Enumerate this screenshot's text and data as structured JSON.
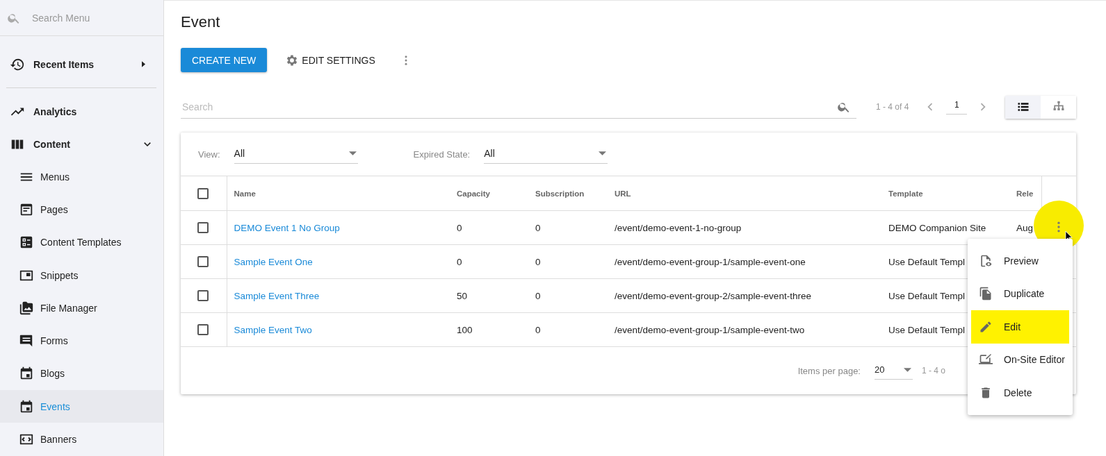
{
  "sidebar": {
    "search": {
      "placeholder": "Search Menu"
    },
    "items": [
      {
        "label": "Recent Items",
        "kind": "toggle",
        "expanded": false
      },
      {
        "kind": "divider"
      },
      {
        "label": "Analytics",
        "kind": "top"
      },
      {
        "label": "Content",
        "kind": "toggle",
        "expanded": true,
        "children": [
          {
            "label": "Menus",
            "selected": false
          },
          {
            "label": "Pages",
            "selected": false
          },
          {
            "label": "Content Templates",
            "selected": false
          },
          {
            "label": "Snippets",
            "selected": false
          },
          {
            "label": "File Manager",
            "selected": false
          },
          {
            "label": "Forms",
            "selected": false
          },
          {
            "label": "Blogs",
            "selected": false
          },
          {
            "label": "Events",
            "selected": true
          },
          {
            "label": "Banners",
            "selected": false
          }
        ]
      }
    ]
  },
  "page": {
    "title": "Event",
    "create_button": "CREATE NEW",
    "settings_button": "EDIT SETTINGS"
  },
  "search": {
    "placeholder": "Search"
  },
  "pager": {
    "range": "1 - 4 of 4",
    "page": "1"
  },
  "view_toggle": [
    {
      "selected": true
    },
    {
      "selected": false
    }
  ],
  "filters": [
    {
      "label": "View:",
      "value": "All"
    },
    {
      "label": "Expired State:",
      "value": "All"
    }
  ],
  "table": {
    "all_checked": false,
    "columns": [
      "Name",
      "Capacity",
      "Subscription",
      "URL",
      "Template",
      "Rele"
    ],
    "rows": [
      {
        "checked": false,
        "name": "DEMO Event 1 No Group",
        "capacity": "0",
        "subscription": "0",
        "url": "/event/demo-event-1-no-group",
        "template": "DEMO Companion Site",
        "release": "Aug"
      },
      {
        "checked": false,
        "name": "Sample Event One",
        "capacity": "0",
        "subscription": "0",
        "url": "/event/demo-event-group-1/sample-event-one",
        "template": "Use Default Templ"
      },
      {
        "checked": false,
        "name": "Sample Event Three",
        "capacity": "50",
        "subscription": "0",
        "url": "/event/demo-event-group-2/sample-event-three",
        "template": "Use Default Templ"
      },
      {
        "checked": false,
        "name": "Sample Event Two",
        "capacity": "100",
        "subscription": "0",
        "url": "/event/demo-event-group-1/sample-event-two",
        "template": "Use Default Templ"
      }
    ],
    "footer": {
      "items_label": "Items per page:",
      "items_value": "20",
      "range": "1 - 4 o"
    }
  },
  "context_menu": {
    "items": [
      {
        "label": "Preview",
        "highlighted": false
      },
      {
        "label": "Duplicate",
        "highlighted": false
      },
      {
        "label": "Edit",
        "highlighted": true
      },
      {
        "label": "On-Site Editor",
        "highlighted": false
      },
      {
        "label": "Delete",
        "highlighted": false
      }
    ]
  }
}
